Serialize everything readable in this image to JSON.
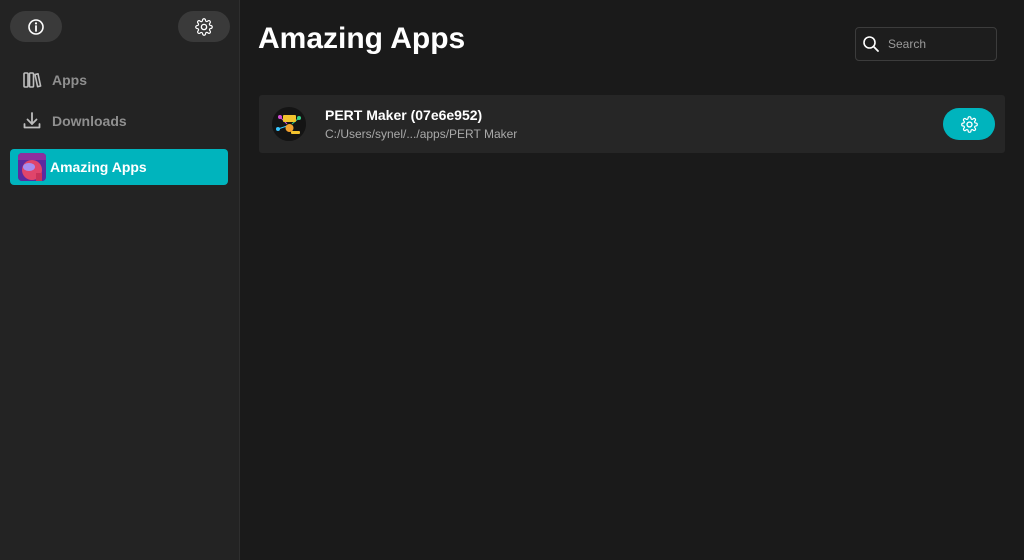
{
  "sidebar": {
    "info_button_icon": "info-icon",
    "settings_button_icon": "gear-icon",
    "items": [
      {
        "label": "Apps",
        "icon": "library-icon"
      },
      {
        "label": "Downloads",
        "icon": "download-icon"
      },
      {
        "label": "Amazing Apps",
        "icon": "avatar",
        "active": true
      }
    ]
  },
  "main": {
    "title": "Amazing Apps",
    "search": {
      "placeholder": "Search",
      "value": ""
    },
    "apps": [
      {
        "name": "PERT Maker (07e6e952)",
        "path": "C:/Users/synel/.../apps/PERT Maker",
        "settings_icon": "gear-icon"
      }
    ]
  },
  "colors": {
    "accent": "#00b4bd",
    "background": "#1a1a1a",
    "sidebar": "#232323",
    "row": "#262626"
  }
}
